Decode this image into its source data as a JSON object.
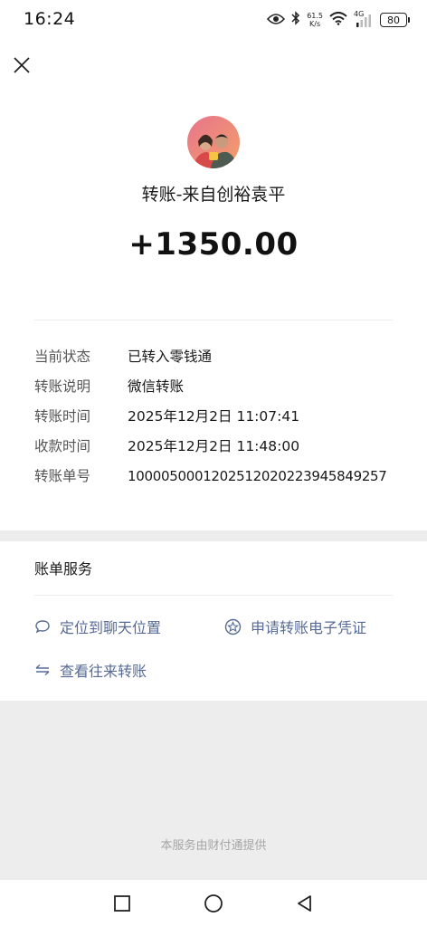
{
  "status_bar": {
    "time": "16:24",
    "net_speed_value": "61.5",
    "net_speed_unit": "K/s",
    "network_type": "4G",
    "battery": "80",
    "icons": [
      "eye-icon",
      "bluetooth-icon",
      "wifi-icon",
      "signal-icon"
    ]
  },
  "header": {
    "close_icon": "close-icon"
  },
  "transfer": {
    "title": "转账-来自创裕袁平",
    "amount": "+1350.00"
  },
  "details": [
    {
      "label": "当前状态",
      "value": "已转入零钱通"
    },
    {
      "label": "转账说明",
      "value": "微信转账"
    },
    {
      "label": "转账时间",
      "value": "2025年12月2日 11:07:41"
    },
    {
      "label": "收款时间",
      "value": "2025年12月2日 11:48:00"
    },
    {
      "label": "转账单号",
      "value": "1000050001202512020223945849257"
    }
  ],
  "services": {
    "heading": "账单服务",
    "links": [
      {
        "label": "定位到聊天位置",
        "icon": "chat-bubble-icon"
      },
      {
        "label": "申请转账电子凭证",
        "icon": "certificate-icon"
      },
      {
        "label": "查看往来转账",
        "icon": "exchange-icon"
      }
    ]
  },
  "footer": {
    "note": "本服务由财付通提供"
  },
  "navigation": {
    "buttons": [
      "recent-apps-icon",
      "home-icon",
      "back-icon"
    ]
  },
  "colors": {
    "link": "#576b95",
    "page_background": "#ededed",
    "card_background": "#ffffff"
  }
}
